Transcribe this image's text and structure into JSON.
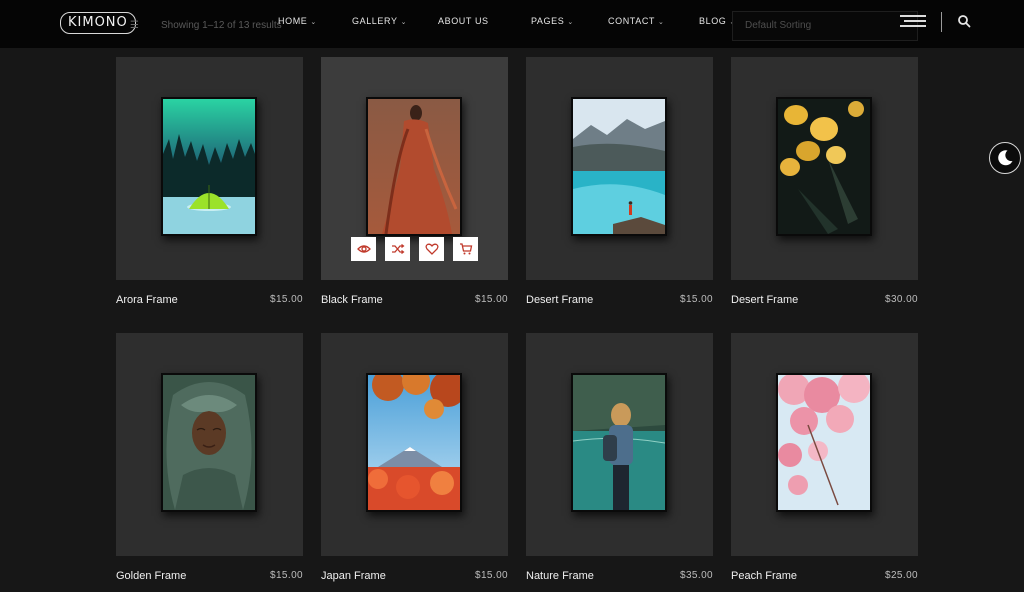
{
  "header": {
    "logo": "KIMONO",
    "results": "Showing 1–12 of 13 results",
    "nav": [
      "HOME",
      "GALLERY",
      "ABOUT US",
      "PAGES",
      "CONTACT",
      "BLOG"
    ],
    "sorting": "Default Sorting"
  },
  "products": [
    {
      "title": "Arora Frame",
      "price": "$15.00"
    },
    {
      "title": "Black Frame",
      "price": "$15.00"
    },
    {
      "title": "Desert Frame",
      "price": "$15.00"
    },
    {
      "title": "Desert Frame",
      "price": "$30.00"
    },
    {
      "title": "Golden Frame",
      "price": "$15.00"
    },
    {
      "title": "Japan Frame",
      "price": "$15.00"
    },
    {
      "title": "Nature Frame",
      "price": "$35.00"
    },
    {
      "title": "Peach Frame",
      "price": "$25.00"
    }
  ],
  "icons": {
    "quick_view": "eye-icon",
    "compare": "shuffle-icon",
    "wishlist": "heart-icon",
    "cart": "cart-icon",
    "theme": "moon-icon",
    "search": "search-icon",
    "menu": "hamburger-icon"
  },
  "colors": {
    "action_icon": "#c0392b",
    "page_bg": "#171717",
    "card_bg": "#2e2e2e"
  }
}
